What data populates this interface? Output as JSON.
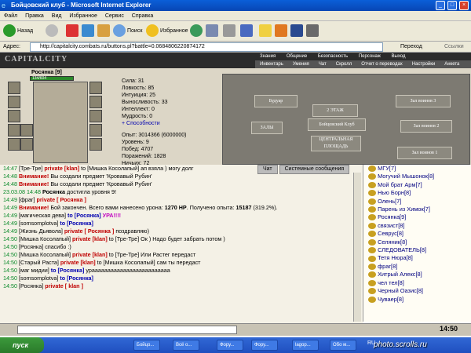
{
  "window": {
    "title": "Бойцовский клуб - Microsoft Internet Explorer"
  },
  "menu": [
    "Файл",
    "Правка",
    "Вид",
    "Избранное",
    "Сервис",
    "Справка"
  ],
  "toolbar": {
    "back": "Назад",
    "search": "Поиск",
    "favorites": "Избранное"
  },
  "address": {
    "label": "Адрес:",
    "url": "http://capitalcity.combats.ru/buttons.pl?battle=0.0684806220874172",
    "go": "Переход",
    "links": "Ссылки"
  },
  "game": {
    "logo": "CAPITALCITY",
    "nav_top": [
      "Знания",
      "Общение",
      "Безопасность",
      "Персонаж",
      "Выход"
    ],
    "nav_bottom": [
      "Инвентарь",
      "Умения",
      "Чат",
      "Скролл",
      "Отчет о переводах",
      "Настройки",
      "Анкета"
    ],
    "character": {
      "name": "Росянка",
      "level": "[9]",
      "hp": "134/604"
    },
    "stats": [
      "Сила: 31",
      "Ловкость: 85",
      "Интуиция: 25",
      "Выносливость: 33",
      "Интеллект: 0",
      "Мудрость: 0"
    ],
    "abilities": "+ Способности",
    "progress": [
      "Опыт: 3014366 (6000000)",
      "Уровень: 9",
      "Побед: 4707",
      "Поражений: 1828",
      "Ничьих: 72"
    ],
    "map_rooms": [
      "Будуар",
      "2 ЭТАЖ",
      "Зал воинов 3",
      "Бойцовский Клуб",
      "ЗАЛЫ",
      "ЦЕНТРАЛЬНАЯ ПЛОЩАДЬ",
      "Зал воинов 2",
      "Зал воинов 1"
    ]
  },
  "chat_tabs": [
    "Чат",
    "Системные сообщения"
  ],
  "chat_lines": [
    {
      "time": "14:47",
      "segments": [
        {
          "c": "k",
          "t": "[Тре-Тре] "
        },
        {
          "c": "r",
          "t": "private [klan] "
        },
        {
          "c": "k",
          "t": "to [Мишка Косолапый] ап взяла ) могу долг"
        }
      ]
    },
    {
      "time": "14:48",
      "segments": [
        {
          "c": "r",
          "t": "Внимание! "
        },
        {
          "c": "k",
          "t": "Вы создали предмет 'Кровавый Рубин'"
        }
      ]
    },
    {
      "time": "14:48",
      "segments": [
        {
          "c": "r",
          "t": "Внимание! "
        },
        {
          "c": "k",
          "t": "Вы создали предмет 'Кровавый Рубин'"
        }
      ]
    },
    {
      "time": "23.03.08 14:48",
      "segments": [
        {
          "c": "s",
          "t": "Росянка "
        },
        {
          "c": "k",
          "t": "достигла уровня 9!"
        }
      ]
    },
    {
      "time": "",
      "segments": []
    },
    {
      "time": "14:49",
      "segments": [
        {
          "c": "k",
          "t": "[фраг] "
        },
        {
          "c": "r",
          "t": "private [ Росянка ] "
        },
        {
          "c": "k",
          "t": ""
        }
      ]
    },
    {
      "time": "14:49",
      "segments": [
        {
          "c": "r",
          "t": "Внимание! "
        },
        {
          "c": "k",
          "t": "Бой закончен. Всего вами нанесено урона: "
        },
        {
          "c": "s",
          "t": "1270 HP"
        },
        {
          "c": "k",
          "t": ". Получено опыта: "
        },
        {
          "c": "s",
          "t": "15187"
        },
        {
          "c": "k",
          "t": " (319.2%)."
        }
      ]
    },
    {
      "time": "14:49",
      "segments": [
        {
          "c": "k",
          "t": "[магическая дева] "
        },
        {
          "c": "b",
          "t": "to [Росянка] "
        },
        {
          "c": "m",
          "t": "УРА!!!!"
        }
      ]
    },
    {
      "time": "",
      "segments": []
    },
    {
      "time": "14:49",
      "segments": [
        {
          "c": "k",
          "t": "[somsomplotva] "
        },
        {
          "c": "b",
          "t": "to [Росянка]"
        }
      ]
    },
    {
      "time": "14:49",
      "segments": [
        {
          "c": "k",
          "t": "[Жизнь Дьявола] "
        },
        {
          "c": "r",
          "t": "private [ Росянка ] "
        },
        {
          "c": "k",
          "t": "поздравляю)"
        }
      ]
    },
    {
      "time": "14:50",
      "segments": [
        {
          "c": "k",
          "t": "[Мишка Косолапый] "
        },
        {
          "c": "r",
          "t": "private [klan] "
        },
        {
          "c": "k",
          "t": "to [Тре-Тре] Ок ) Надо будет забрать потом )"
        }
      ]
    },
    {
      "time": "14:50",
      "segments": [
        {
          "c": "k",
          "t": "[Росянка] спасибо :)"
        }
      ]
    },
    {
      "time": "14:50",
      "segments": [
        {
          "c": "k",
          "t": "[Мишка Косолапый] "
        },
        {
          "c": "r",
          "t": "private [klan] "
        },
        {
          "c": "k",
          "t": "to [Тре-Тре] Или Растег передаст"
        }
      ]
    },
    {
      "time": "14:50",
      "segments": [
        {
          "c": "k",
          "t": "[Старый Раста] "
        },
        {
          "c": "r",
          "t": "private [klan] "
        },
        {
          "c": "k",
          "t": "to [Мишка Косолапый] сам ты передаст"
        }
      ]
    },
    {
      "time": "14:50",
      "segments": [
        {
          "c": "k",
          "t": "[маг мидии] "
        },
        {
          "c": "b",
          "t": "to [Росянка] "
        },
        {
          "c": "k",
          "t": "урааааааааааааааааааааааааа"
        }
      ]
    },
    {
      "time": "",
      "segments": []
    },
    {
      "time": "14:50",
      "segments": [
        {
          "c": "k",
          "t": "[somsomplotva] "
        },
        {
          "c": "b",
          "t": "to [Росянка]"
        }
      ]
    },
    {
      "time": "",
      "segments": []
    },
    {
      "time": "14:50",
      "segments": [
        {
          "c": "k",
          "t": "[Росянка] "
        },
        {
          "c": "r",
          "t": "private [ klan ]"
        }
      ]
    }
  ],
  "users": [
    "МГУ[7]",
    "Могучий Мышонок[8]",
    "Мой брат Арм[7]",
    "Нью Борн[8]",
    "Олень[7]",
    "Парень из Химок[7]",
    "Росянка[9]",
    "связист[8]",
    "Севрус[8]",
    "Селяник[8]",
    "СЛЕДОВАТЕЛЬ[8]",
    "Тетя Нюра[8]",
    "фраг[8]",
    "Хитрый Алекс[8]",
    "чел тел[8]",
    "Черный Оазис[8]",
    "Чуваер[8]"
  ],
  "statusbar": {
    "clock": "14:50"
  },
  "taskbar": {
    "start": "пуск",
    "tasks": [
      "Бойцо...",
      "Всё о...",
      "Фору...",
      "Фору...",
      "lagop...",
      "Обо м..."
    ],
    "lang": "RU"
  },
  "watermark": "photo.scrolls.ru",
  "colors": {
    "title": "#0846b4",
    "private": "#c00000",
    "to": "#0000b0",
    "time": "#0a8a2a"
  }
}
